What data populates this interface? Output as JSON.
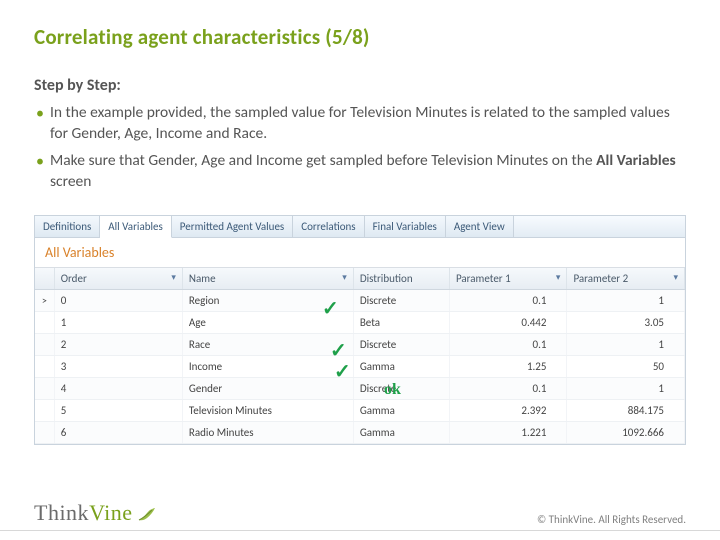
{
  "title": "Correlating agent characteristics (5/8)",
  "step_label": "Step by Step:",
  "bullets": [
    "In the example provided, the sampled value for Television Minutes is related to the sampled values for Gender, Age, Income and Race.",
    "Make sure that Gender, Age and Income get sampled before Television Minutes on the All Variables screen"
  ],
  "bold_term": "All Variables",
  "tabs": [
    "Definitions",
    "All Variables",
    "Permitted Agent Values",
    "Correlations",
    "Final Variables",
    "Agent View"
  ],
  "active_tab_index": 1,
  "panel_subtitle": "All Variables",
  "columns": [
    "Order",
    "Name",
    "Distribution",
    "Parameter 1",
    "Parameter 2"
  ],
  "rows": [
    {
      "order": "0",
      "name": "Region",
      "dist": "Discrete",
      "p1": "0.1",
      "p2": "1"
    },
    {
      "order": "1",
      "name": "Age",
      "dist": "Beta",
      "p1": "0.442",
      "p2": "3.05"
    },
    {
      "order": "2",
      "name": "Race",
      "dist": "Discrete",
      "p1": "0.1",
      "p2": "1"
    },
    {
      "order": "3",
      "name": "Income",
      "dist": "Gamma",
      "p1": "1.25",
      "p2": "50"
    },
    {
      "order": "4",
      "name": "Gender",
      "dist": "Discrete",
      "p1": "0.1",
      "p2": "1"
    },
    {
      "order": "5",
      "name": "Television Minutes",
      "dist": "Gamma",
      "p1": "2.392",
      "p2": "884.175"
    },
    {
      "order": "6",
      "name": "Radio Minutes",
      "dist": "Gamma",
      "p1": "1.221",
      "p2": "1092.666"
    }
  ],
  "annotations": {
    "ok": "ok"
  },
  "logo": {
    "part1": "Think",
    "part2": "Vine"
  },
  "copyright": "© ThinkVine.  All Rights Reserved."
}
